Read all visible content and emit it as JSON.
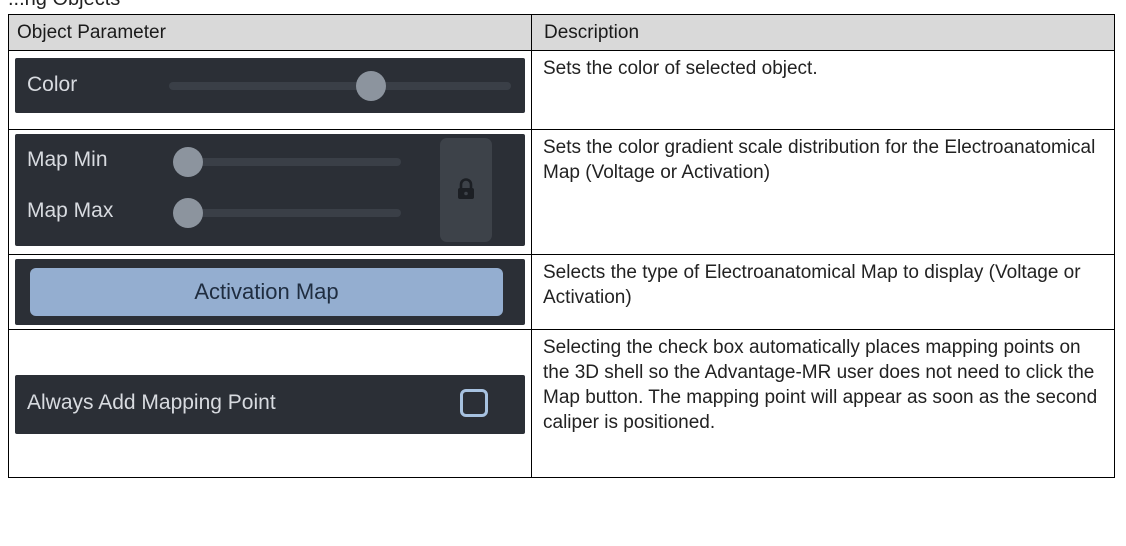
{
  "header_fragment": "...ng Objects",
  "table": {
    "col1_header": "Object Parameter",
    "col2_header": "Description",
    "rows": [
      {
        "widget": {
          "label": "Color",
          "slider_value": 0.6
        },
        "description": "Sets the color of selected object."
      },
      {
        "widget": {
          "min_label": "Map Min",
          "max_label": "Map Max",
          "min_value": 0.0,
          "max_value": 0.0,
          "lock_icon": "lock-icon"
        },
        "description": "Sets the color gradient scale distribution for the Electroanatomical Map (Voltage or Activation)"
      },
      {
        "widget": {
          "button_label": "Activation Map"
        },
        "description": "Selects the type of Electroanatomical Map to display (Voltage or Activation)"
      },
      {
        "widget": {
          "checkbox_label": "Always Add Mapping Point",
          "checked": false
        },
        "description": "Selecting the check box automatically places mapping points on the 3D shell so the Advantage-MR user does not need to click the Map button. The mapping point will appear as soon as the second caliper is positioned."
      }
    ]
  },
  "colors": {
    "header_bg": "#d9d9d9",
    "panel_bg": "#2b2f36",
    "button_bg": "#94aed0",
    "checkbox_border": "#a7c2e0"
  }
}
